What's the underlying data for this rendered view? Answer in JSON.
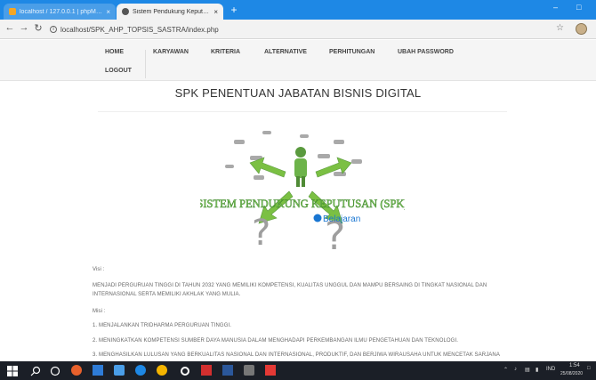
{
  "browser": {
    "tabs": [
      {
        "label": "localhost / 127.0.0.1 | phpMyAd",
        "close": "×",
        "favicon": "phpmyadmin-icon"
      },
      {
        "label": "Sistem Pendukung Keputusan",
        "close": "×",
        "favicon": "chrome-icon"
      }
    ],
    "new_tab": "+",
    "url": "localhost/SPK_AHP_TOPSIS_SASTRA/index.php",
    "window_controls": [
      "–",
      "□"
    ]
  },
  "nav": {
    "items": [
      "HOME",
      "KARYAWAN",
      "KRITERIA",
      "ALTERNATIVE",
      "PERHITUNGAN",
      "UBAH PASSWORD",
      "LOGOUT"
    ]
  },
  "main": {
    "title": "SPK PENENTUAN JABATAN BISNIS DIGITAL",
    "hero": {
      "caption": "SISTEM PENDUKUNG KEPUTUSAN (SPK)",
      "brand": "Belajaran"
    },
    "visi_label": "Visi :",
    "visi_text": "MENJADI PERGURUAN TINGGI DI TAHUN 2032 YANG MEMILIKI KOMPETENSI, KUALITAS UNGGUL DAN MAMPU BERSAING DI TINGKAT NASIONAL DAN INTERNASIONAL SERTA MEMILIKI AKHLAK YANG MULIA.",
    "misi_label": "Misi :",
    "misi": [
      "1. MENJALANKAN TRIDHARMA PERGURUAN TINGGI.",
      "2. MENINGKATKAN KOMPETENSI SUMBER DAYA MANUSIA DALAM MENGHADAPI PERKEMBANGAN ILMU PENGETAHUAN DAN TEKNOLOGI.",
      "3. MENGHASILKAN LULUSAN YANG BERKUALITAS NASIONAL DAN INTERNASIONAL, PRODUKTIF, DAN BERJIWA WIRAUSAHA UNTUK MENCETAK SARJANA"
    ]
  },
  "taskbar": {
    "tray_lang": "IND",
    "time": "1:54",
    "date": "25/08/2020"
  },
  "colors": {
    "titlebar": "#1e88e5",
    "arrow_green": "#7bc043",
    "hero_text": "#4caf50",
    "taskbar": "#1b1f27"
  }
}
